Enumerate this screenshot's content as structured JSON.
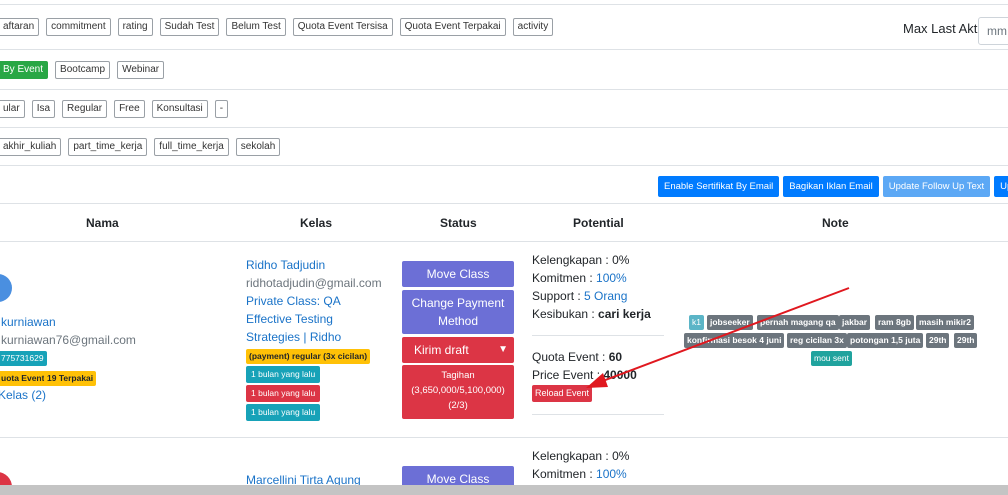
{
  "filters": {
    "row1": [
      "aftaran",
      "commitment",
      "rating",
      "Sudah Test",
      "Belum Test",
      "Quota Event Tersisa",
      "Quota Event Terpakai",
      "activity"
    ],
    "row2": [
      "By Event",
      "Bootcamp",
      "Webinar"
    ],
    "row3": [
      "ular",
      "Isa",
      "Regular",
      "Free",
      "Konsultasi",
      "-"
    ],
    "row4": [
      "akhir_kuliah",
      "part_time_kerja",
      "full_time_kerja",
      "sekolah"
    ],
    "max_last_label": "Max Last Aktif :",
    "max_last_placeholder": "mm"
  },
  "actions": [
    "Enable Sertifikat By Email",
    "Bagikan Iklan Email",
    "Update Follow Up Text",
    "Update Status"
  ],
  "table": {
    "headers": [
      "Nama",
      "Kelas",
      "Status",
      "Potential",
      "Note"
    ],
    "row1": {
      "name": "kurniawan",
      "email": "kurniawan76@gmail.com",
      "phone": "775731629",
      "badges": [
        "uota Event",
        "19 Terpakai"
      ],
      "kelas_link": "Kelas (2)",
      "mentor": "Ridho Tadjudin",
      "mentor_email": "ridhotadjudin@gmail.com",
      "class_title": "Private Class: QA Effective Testing Strategies | Ridho Tadjudin",
      "payment_badge": "(payment) regular (3x cicilan)",
      "time_badges": [
        "1 bulan yang lalu",
        "1 bulan yang lalu",
        "1 bulan yang lalu"
      ],
      "move_class": "Move Class",
      "change_payment": "Change Payment Method",
      "draft_select": "Kirim draft",
      "tagihan_title": "Tagihan",
      "tagihan_amount": "(3,650,000/5,100,000)",
      "tagihan_count": "(2/3)",
      "kelengkapan_label": "Kelengkapan : ",
      "kelengkapan_value": "0%",
      "komitmen_label": "Komitmen : ",
      "komitmen_value": "100%",
      "support_label": "Support : ",
      "support_value": "5 Orang",
      "kesibukan_label": "Kesibukan : ",
      "kesibukan_value": "cari kerja",
      "quota_label": "Quota Event : ",
      "quota_value": "60",
      "price_label": "Price Event : ",
      "price_value": "40000",
      "reload_event": "Reload Event",
      "notes": [
        "k1",
        "jobseeker",
        "pernah magang qa",
        "jakbar",
        "ram 8gb",
        "masih mikir2",
        "konfirmasi besok 4 juni",
        "reg cicilan 3x",
        "potongan 1,5 juta",
        "29th",
        "29th",
        "mou sent"
      ]
    },
    "row2": {
      "mentor": "Marcellini Tirta Agung",
      "move_class": "Move Class",
      "kelengkapan_label": "Kelengkapan : ",
      "kelengkapan_value": "0%",
      "komitmen_label": "Komitmen : ",
      "komitmen_value": "100%"
    }
  },
  "colors": {
    "primary": "#007bff",
    "success": "#28a745",
    "purple": "#6c6fd6",
    "danger": "#dc3545",
    "info": "#17a2b8",
    "warning": "#ffc107",
    "secondary": "#6c757d",
    "annotation_arrow": "#e0181f"
  }
}
